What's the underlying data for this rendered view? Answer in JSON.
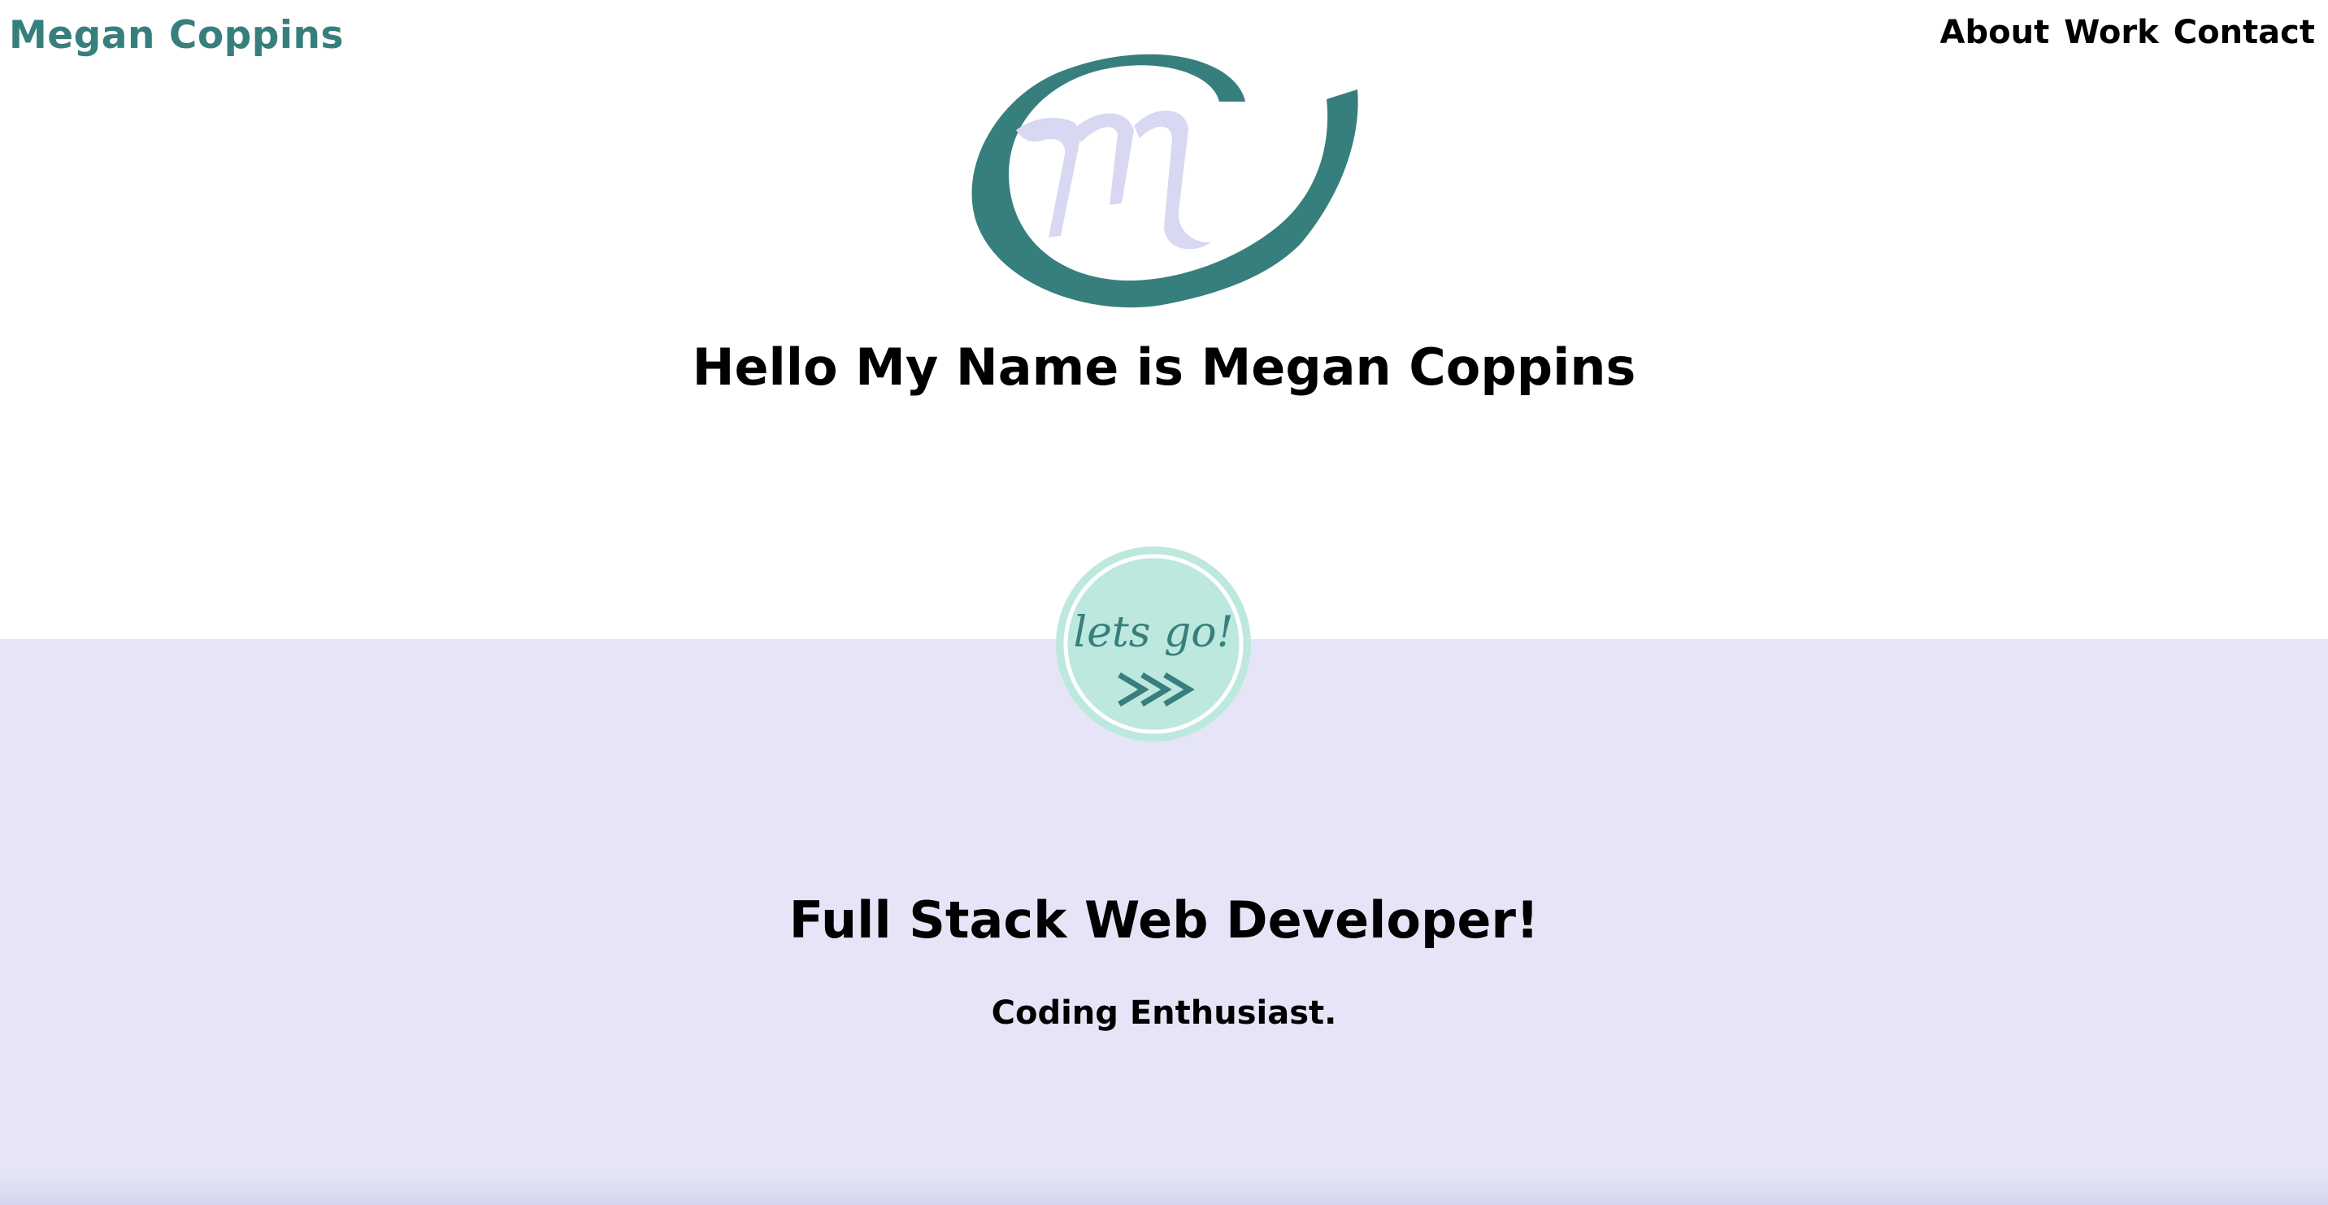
{
  "header": {
    "brand": "Megan Coppins",
    "nav": [
      {
        "label": "About"
      },
      {
        "label": "Work"
      },
      {
        "label": "Contact"
      }
    ]
  },
  "logo": {
    "icon": "megan-coppins-m-monogram-logo",
    "colors": {
      "swoosh": "#377f7d",
      "letter": "#d8d8f2"
    }
  },
  "hero": {
    "title": "Hello My Name is Megan Coppins"
  },
  "cta": {
    "text": "lets go!",
    "icon": "triple-chevron-right-icon",
    "colors": {
      "fill": "#bde8de",
      "ring": "#ffffff",
      "ink": "#377f7d"
    }
  },
  "intro": {
    "role": "Full Stack Web Developer!",
    "tagline": "Coding Enthusiast."
  },
  "colors": {
    "accent": "#377f7d",
    "band": "#e5e5f7",
    "text": "#000000",
    "background": "#ffffff"
  }
}
